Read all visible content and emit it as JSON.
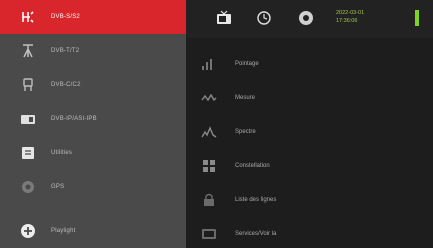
{
  "sidebar": {
    "items": [
      {
        "icon": "antenna-signal-icon",
        "label": "DVB-S/S2",
        "active": true
      },
      {
        "icon": "antenna-tower-icon",
        "label": "DVB-T/T2",
        "active": false
      },
      {
        "icon": "cable-plug-icon",
        "label": "DVB-C/C2",
        "active": false
      },
      {
        "icon": "ip-box-icon",
        "label": "DVB-IP/ASI-IPB",
        "active": false
      },
      {
        "icon": "document-icon",
        "label": "Utilities",
        "active": false
      },
      {
        "icon": "gear-icon",
        "label": "GPS",
        "active": false
      },
      {
        "icon": "add-circle-icon",
        "label": "Playlight",
        "active": false
      }
    ]
  },
  "topbar": {
    "date": "2022-03-01",
    "time": "17:36:06"
  },
  "menu": {
    "items": [
      {
        "icon": "signal-bars-icon",
        "label": "Pointage"
      },
      {
        "icon": "waveform-icon",
        "label": "Mesure"
      },
      {
        "icon": "spectrum-icon",
        "label": "Spectre"
      },
      {
        "icon": "constellation-icon",
        "label": "Constellation"
      },
      {
        "icon": "lock-icon",
        "label": "Liste des lignes"
      },
      {
        "icon": "tv-icon",
        "label": "Services/Voir la"
      }
    ]
  },
  "colors": {
    "accent": "#d8262c",
    "sidebar_bg": "#4a4a4a",
    "main_bg": "#1d1d1d",
    "time_text": "#9cc84a"
  }
}
